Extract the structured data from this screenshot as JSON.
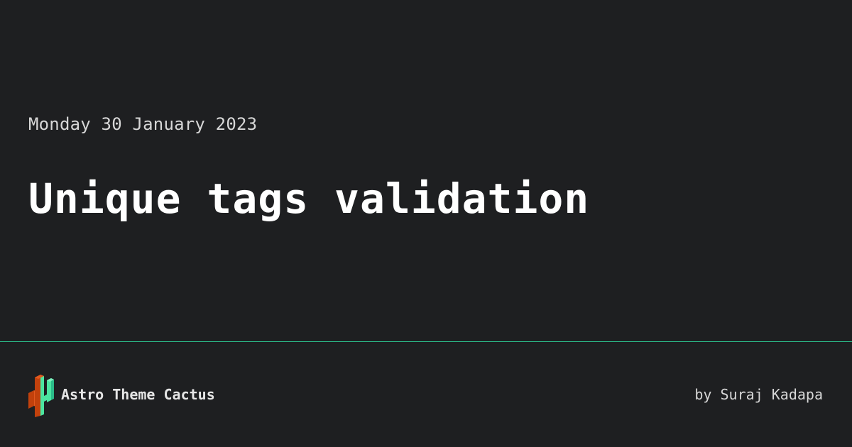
{
  "post": {
    "date": "Monday 30 January 2023",
    "title": "Unique tags validation"
  },
  "footer": {
    "site_name": "Astro Theme Cactus",
    "author": "by Suraj Kadapa"
  },
  "colors": {
    "background": "#1e1f21",
    "divider": "#2bbc89",
    "logo_green": "#4be5a0",
    "logo_orange": "#c2410c"
  },
  "icons": {
    "logo": "cactus-logo-icon"
  }
}
